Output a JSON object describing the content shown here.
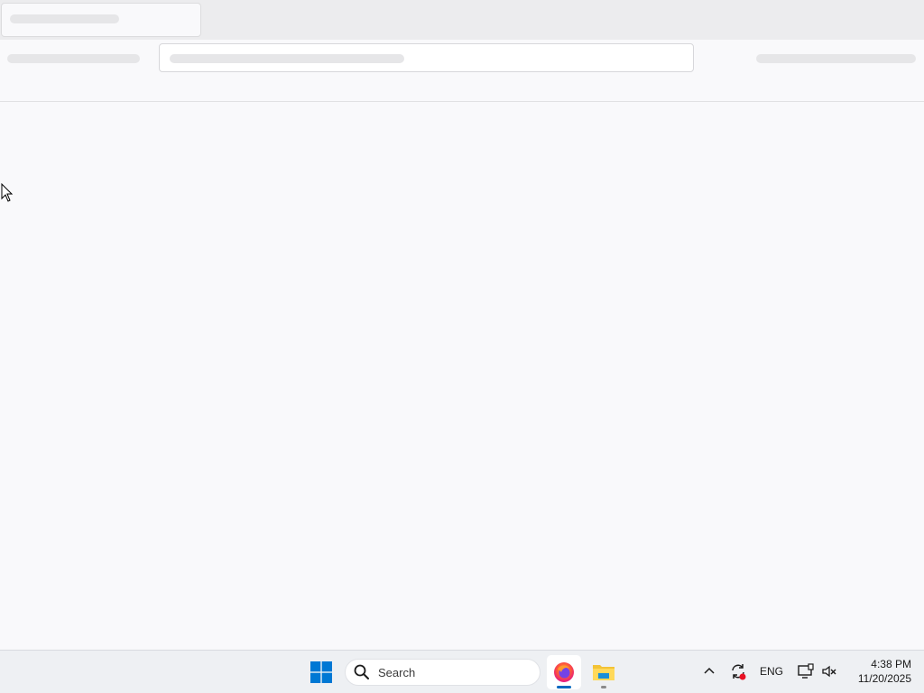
{
  "taskbar": {
    "search_label": "Search",
    "language": "ENG",
    "time": "4:38 PM",
    "date": "11/20/2025",
    "pinned_apps": [
      "Firefox",
      "File Explorer"
    ]
  },
  "colors": {
    "accent": "#0067c0",
    "skeleton": "#e6e6e8",
    "page_background": "#f9f9fb"
  },
  "icons": {
    "start": "windows-logo-icon",
    "search": "search-icon",
    "tray_overflow": "chevron-up-icon",
    "sync": "sync-icon",
    "display": "monitor-icon",
    "volume": "speaker-muted-icon"
  }
}
